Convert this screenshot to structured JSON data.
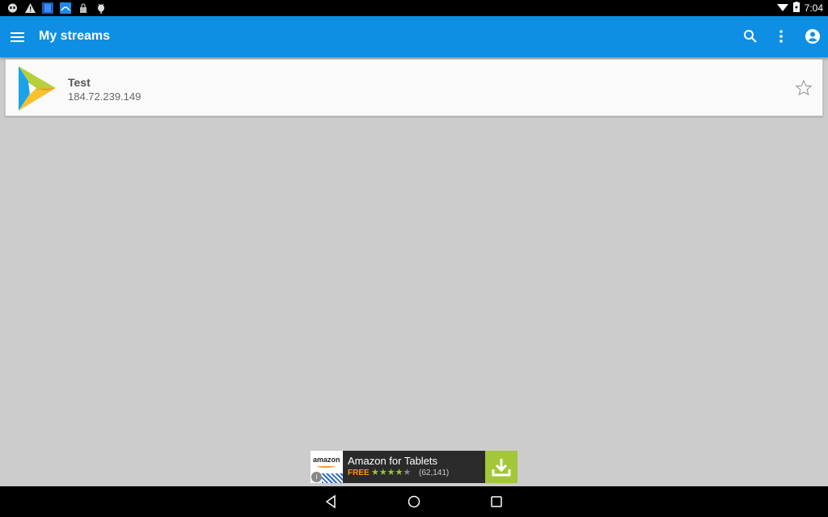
{
  "status_bar": {
    "left_icons": [
      "hangouts-icon",
      "warning-icon",
      "blue-app-icon",
      "cloud-app-icon",
      "lock-icon",
      "android-debug-icon"
    ],
    "time": "7:04"
  },
  "app_bar": {
    "title": "My streams",
    "accent_color": "#0f8fe3"
  },
  "streams": [
    {
      "name": "Test",
      "address": "184.72.239.149",
      "favorite": false
    }
  ],
  "ad": {
    "logo_text": "amazon",
    "title": "Amazon for Tablets",
    "price": "FREE",
    "rating_stars": 4,
    "rating_max": 5,
    "rating_count": "(62,141)",
    "info_glyph": "i"
  }
}
